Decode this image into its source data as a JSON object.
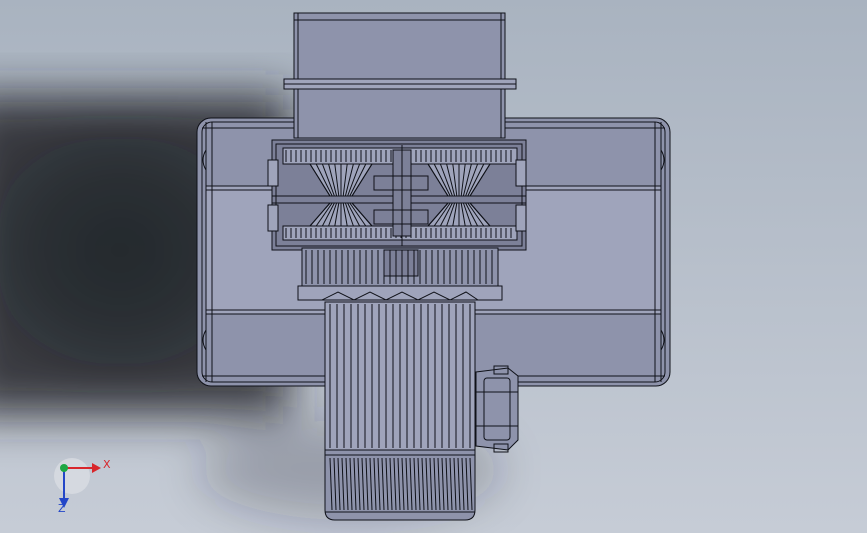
{
  "viewport": {
    "background_top": "#a9b3c0",
    "background_bottom": "#c6ccd6",
    "shadow_color": "#24272c"
  },
  "model": {
    "fill_light": "#9fa4bb",
    "fill_mid": "#8e93ab",
    "fill_dark": "#7c8098",
    "line_color": "#0f1118"
  },
  "triad": {
    "x_label": "X",
    "z_label": "Z",
    "x_color": "#d8262b",
    "z_color": "#2346c8",
    "y_color": "#1ea844"
  }
}
